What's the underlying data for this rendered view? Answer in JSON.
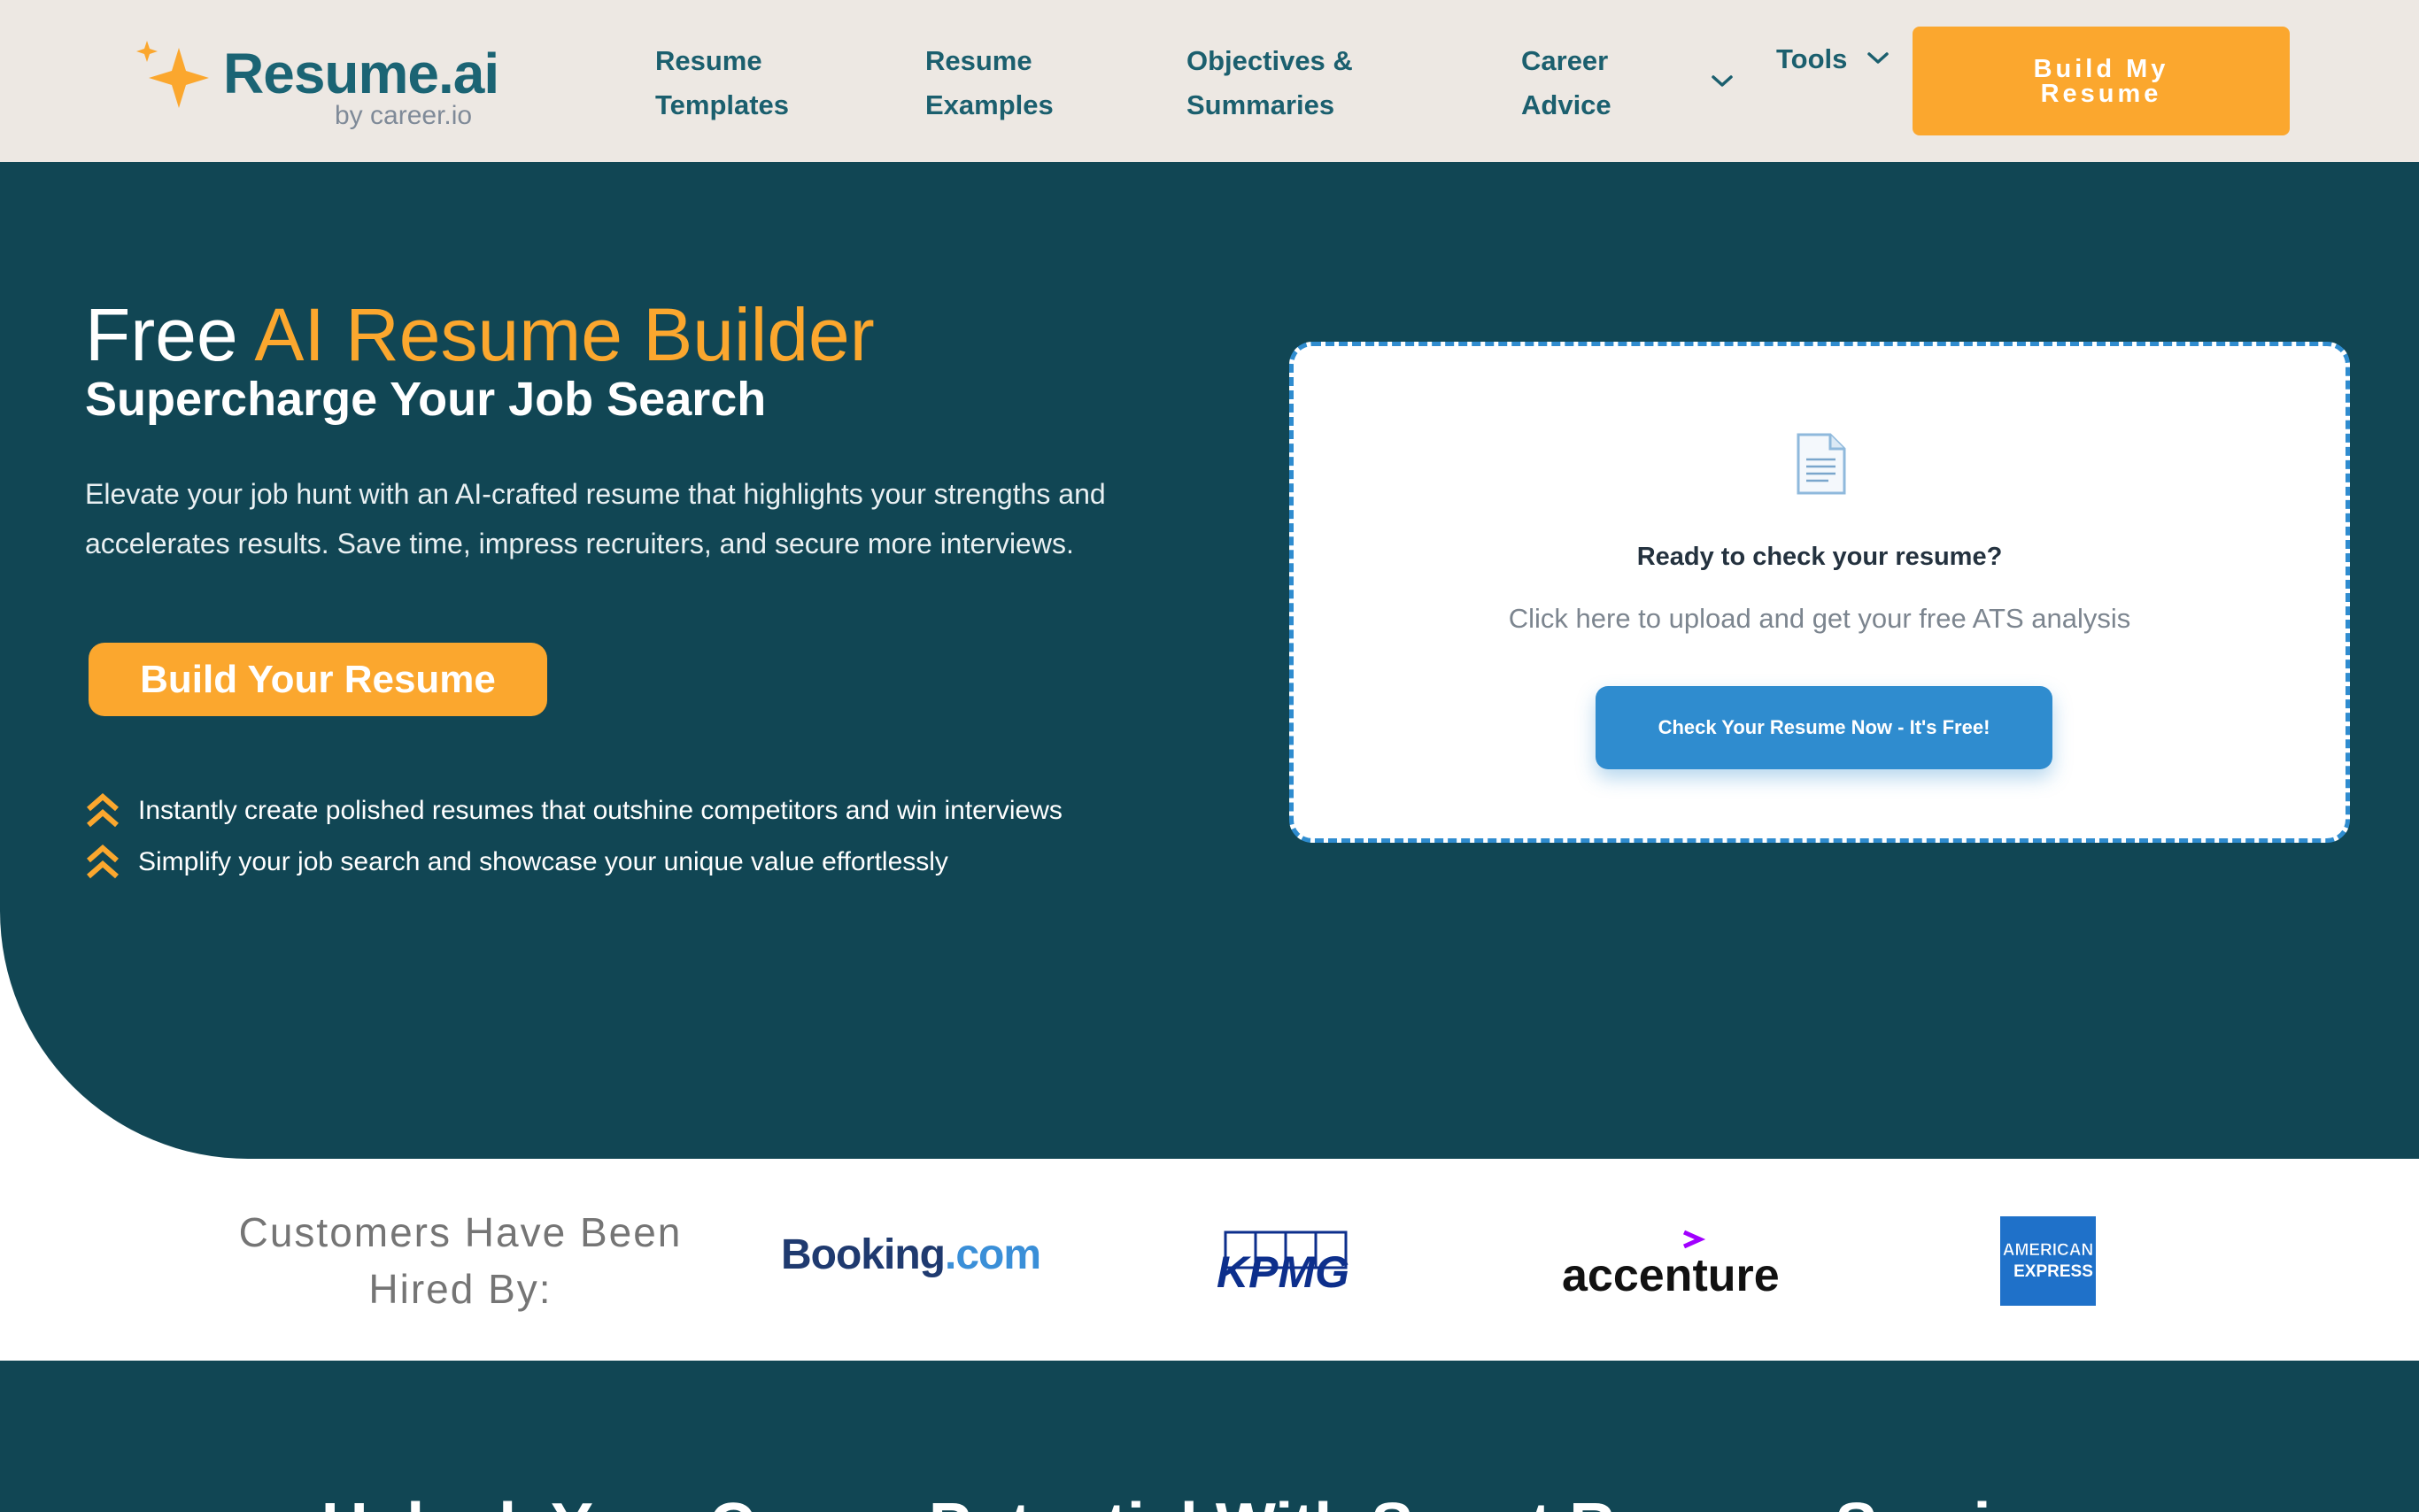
{
  "header": {
    "logo": {
      "name": "Resume.ai",
      "sub": "by career.io"
    },
    "nav": [
      {
        "line1": "Resume",
        "line2": "Templates"
      },
      {
        "line1": "Resume",
        "line2": "Examples"
      },
      {
        "line1": "Objectives &",
        "line2": "Summaries"
      },
      {
        "line1": "Career",
        "line2": "Advice"
      }
    ],
    "tools_label": "Tools",
    "cta_label": "Build My Resume"
  },
  "hero": {
    "title_plain": "Free",
    "title_accent": "AI Resume Builder",
    "subtitle": "Supercharge Your Job Search",
    "description": "Elevate your job hunt with an AI-crafted resume that highlights your strengths and accelerates results. Save time, impress recruiters, and secure more interviews.",
    "cta_label": "Build Your Resume",
    "bullets": [
      "Instantly create polished resumes that outshine competitors and win interviews",
      "Simplify your job search and showcase your unique value effortlessly"
    ]
  },
  "upload_card": {
    "icon": "document-icon",
    "title": "Ready to check your resume?",
    "text": "Click here to upload and get your free ATS analysis",
    "cta_label": "Check Your Resume Now - It's Free!"
  },
  "hired_by": {
    "label": "Customers Have Been Hired By:",
    "logos": {
      "booking_main": "Booking",
      "booking_suffix": ".com",
      "kpmg": "KPMG",
      "accenture": "accenture",
      "amex_line1": "AMERICAN",
      "amex_line2": "EXPRESS"
    }
  },
  "bottom": {
    "heading": "Unlock Your Career Potential With Smart Resume Services"
  },
  "colors": {
    "brand_teal": "#114654",
    "accent_orange": "#fba72e",
    "cta_blue": "#2f8ccf",
    "header_bg": "#ede8e3"
  }
}
